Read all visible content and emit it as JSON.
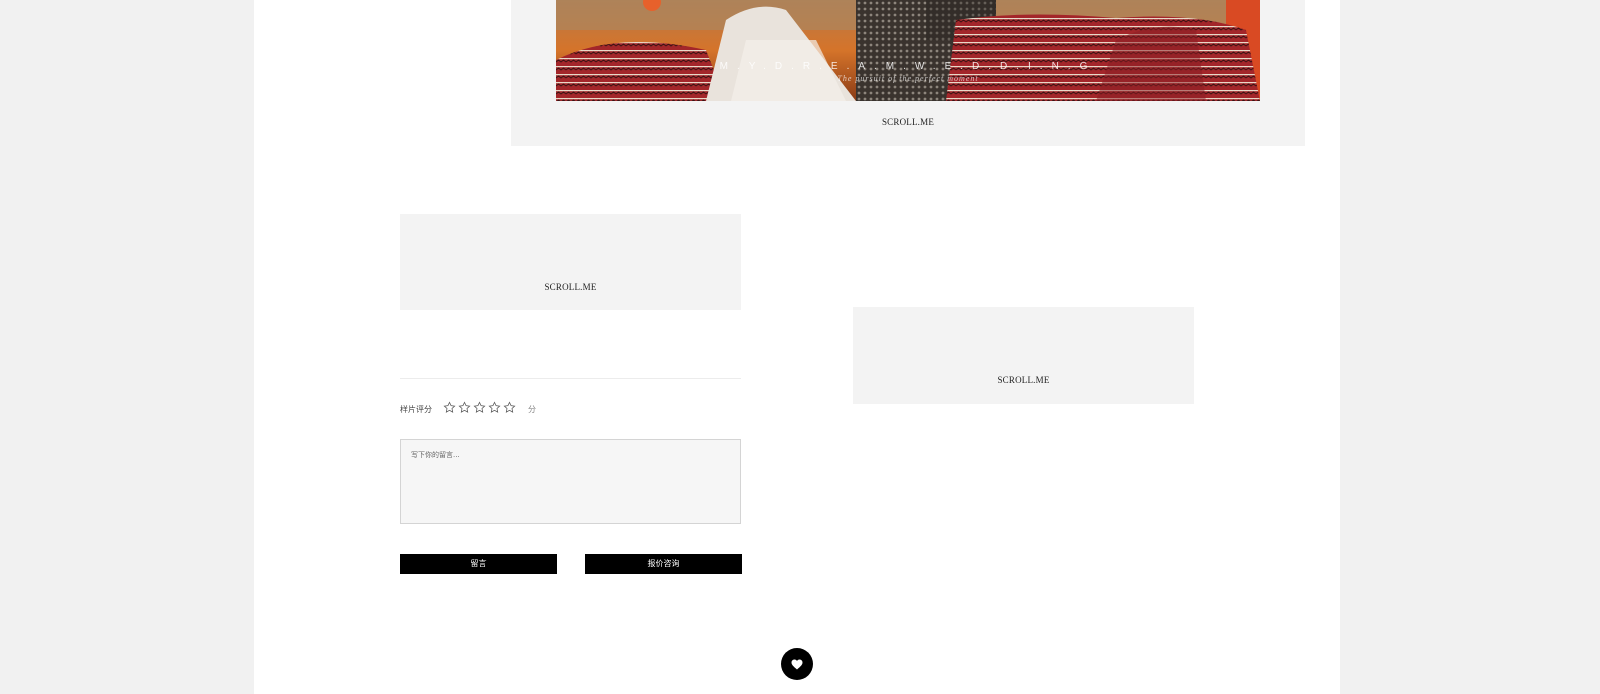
{
  "top_card": {
    "photo_brand": "M.Y.D.R.E.A.M.W.E.D.D.I.N.G",
    "photo_subtitle": "The pursuit of the perfect moment",
    "scroll_label": "SCROLL.ME"
  },
  "left_card": {
    "scroll_label": "SCROLL.ME"
  },
  "right_card": {
    "scroll_label": "SCROLL.ME"
  },
  "rating": {
    "label": "样片评分",
    "unit": "分",
    "max_stars": 5,
    "value": 0
  },
  "message": {
    "placeholder": "写下你的留言...",
    "value": ""
  },
  "buttons": {
    "leave_message": "留言",
    "price_inquiry": "报价咨询"
  },
  "icons": {
    "star": "star-outline-icon",
    "favorite": "heart-icon"
  },
  "colors": {
    "page_bg": "#f1f1f1",
    "card_bg": "#f3f3f3",
    "button_bg": "#000000"
  }
}
